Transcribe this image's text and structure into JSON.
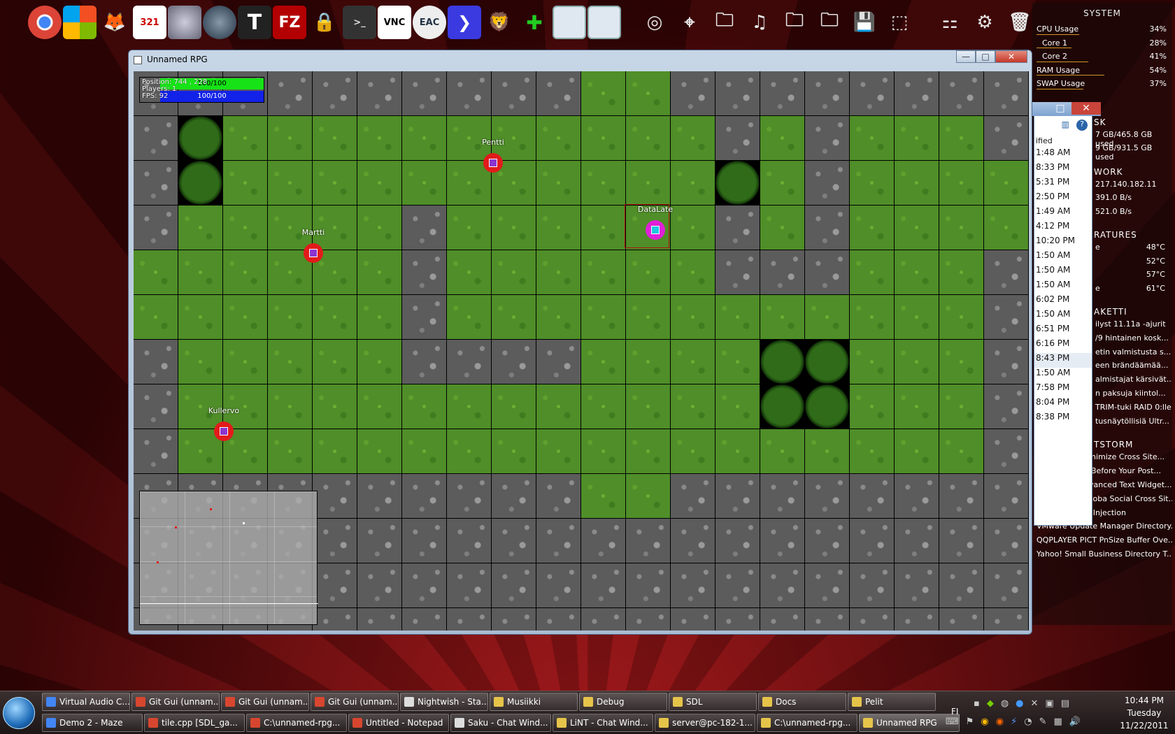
{
  "dock": {
    "group1": [
      "Chrome",
      "MS",
      "Fox",
      "321",
      "Disk",
      "Ghost",
      "T",
      "FZ",
      "Lock",
      "Putty",
      "VNC",
      "EAC",
      "VS",
      "Lion",
      "Git",
      "Win1",
      "Win2"
    ],
    "group2": [
      "CD",
      "Mouse",
      "Folder1",
      "Music",
      "Folder2",
      "Folder3",
      "Save",
      "Cursor",
      "Network",
      "Gear",
      "Trash"
    ]
  },
  "system": {
    "title": "SYSTEM",
    "rows": [
      {
        "label": "CPU Usage",
        "value": "34%",
        "indent": false,
        "pct": 0.34
      },
      {
        "label": "Core 1",
        "value": "28%",
        "indent": true,
        "pct": 0.28
      },
      {
        "label": "Core 2",
        "value": "41%",
        "indent": true,
        "pct": 0.41
      },
      {
        "label": "RAM Usage",
        "value": "54%",
        "indent": false,
        "pct": 0.54
      },
      {
        "label": "SWAP Usage",
        "value": "37%",
        "indent": false,
        "pct": 0.37
      }
    ],
    "disk_head": "SK",
    "disk_lines": [
      "7 GB/465.8 GB used",
      "9 GB/931.5 GB used"
    ],
    "network_head": "WORK",
    "network_lines": [
      "217.140.182.11",
      "391.0 B/s",
      "521.0 B/s"
    ],
    "temps_head": "RATURES",
    "temps": [
      [
        "e",
        "48°C"
      ],
      [
        "",
        "52°C"
      ],
      [
        "",
        "57°C"
      ],
      [
        "e",
        "61°C"
      ]
    ],
    "news_head": "AKETTI",
    "news": [
      "ilyst 11.11a -ajurit",
      "/9 hintainen kosk...",
      "etin valmistusta s...",
      "een brändäämää...",
      "almistajat kärsivät...",
      "n paksuja kiintol...",
      "TRIM-tuki RAID 0:lle",
      "tusnäytöllisiä Ultr..."
    ],
    "storm_head": "TSTORM",
    "storm": [
      "nimize Cross Site...",
      "Before Your Post...",
      "WordPress Advanced Text Widget...",
      "WordPress Lanoba Social Cross Sit...",
      "ITHorizon SQL Injection",
      "VMware Update Manager Directory...",
      "QQPLAYER PICT PnSize Buffer Ove...",
      "Yahoo! Small Business Directory T..."
    ]
  },
  "bgwindow": {
    "header": "ified",
    "times": [
      "1:48 AM",
      "8:33 PM",
      "5:31 PM",
      "2:50 PM",
      "1:49 AM",
      "4:12 PM",
      "10:20 PM",
      "1:50 AM",
      "1:50 AM",
      "1:50 AM",
      "6:02 PM",
      "1:50 AM",
      "6:51 PM",
      "6:16 PM",
      "8:43 PM",
      "1:50 AM",
      "7:58 PM",
      "8:04 PM",
      "8:38 PM"
    ]
  },
  "window": {
    "title": "Unnamed RPG",
    "minimize": "—",
    "maximize": "□",
    "close": "✕"
  },
  "hud": {
    "position": "Position: 744 , 228",
    "players": "Players: 1",
    "fps": "FPS: 92",
    "hp": "100/100",
    "mp": "100/100"
  },
  "map": {
    "legend": {
      "S": "stone",
      "G": "grass",
      "B": "bush"
    },
    "rows": [
      "SSSSSSSSSSGGSSSSSSSS",
      "SBGGGGGGGGGGGSGSGGGS",
      "SBGGGGGGGGGGGBGSGGGG",
      "SGGGGGSGGGGGGSGSGGGG",
      "GGGGGGSGGGGGGSSSGGGS",
      "GGGGGGSGGGGGGGGGGGGS",
      "SGGGGGSSSSGGGGBBGGGS",
      "SGGGGGGGGGGGGGBBGGGS",
      "SGGGGGGGGGGGGGGGGGGS",
      "SSSSSSSSSSGGSSSSSSSS",
      "SSSSSSSSSSSSSSSSSSSS",
      "SSSSSSSSSSSSSSSSSSSS",
      "SSSSSSSSSSSSSSSSSSSS"
    ]
  },
  "players": [
    {
      "name": "Pentti"
    },
    {
      "name": "Martti"
    },
    {
      "name": "Kullervo"
    },
    {
      "name": "DataLate"
    }
  ],
  "taskbar": {
    "row1": [
      "Virtual Audio C...",
      "Git Gui (unnam...",
      "Git Gui (unnam...",
      "Git Gui (unnam...",
      "Nightwish - Sta...",
      "Musiikki",
      "Debug",
      "SDL",
      "Docs",
      "Pelit"
    ],
    "row2": [
      "Demo 2 - Maze",
      "tile.cpp [SDL_ga...",
      "C:\\unnamed-rpg...",
      "Untitled - Notepad",
      "Saku - Chat Wind...",
      "LiNT - Chat Wind...",
      "server@pc-182-1...",
      "C:\\unnamed-rpg...",
      "Unnamed RPG"
    ],
    "lang": "FI",
    "time": "10:44 PM",
    "day": "Tuesday",
    "date": "11/22/2011"
  }
}
